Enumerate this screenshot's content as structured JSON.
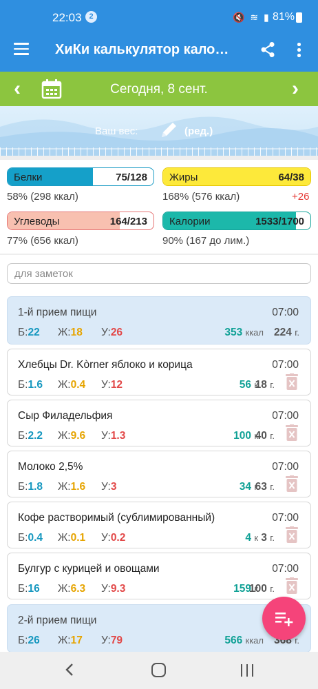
{
  "status_bar": {
    "time": "22:03",
    "notification_count": "2",
    "icons": "🔇 ≋ ▮",
    "battery": "81%"
  },
  "app_bar": {
    "title": "ХиКи калькулятор кало…"
  },
  "date_bar": {
    "date": "Сегодня, 8 сент."
  },
  "weight": {
    "label": "Ваш вес:",
    "edit": "(ред.)"
  },
  "macros": {
    "protein": {
      "name": "Белки",
      "value": "75/128",
      "fill": 0.586,
      "sub": "58% (298 ккал)"
    },
    "fat": {
      "name": "Жиры",
      "value": "64/38",
      "fill": 1.0,
      "sub": "168% (576 ккал)",
      "over": "+26"
    },
    "carbs": {
      "name": "Углеводы",
      "value": "164/213",
      "fill": 0.77,
      "sub": "77% (656 ккал)"
    },
    "calories": {
      "name": "Калории",
      "value": "1533/1700",
      "fill": 0.9,
      "sub": "90% (167 до лим.)"
    }
  },
  "notes": {
    "placeholder": "для заметок"
  },
  "labels": {
    "p": "Б:",
    "f": "Ж:",
    "c": "У:",
    "kcal": "ккал",
    "k": "к",
    "g": "г."
  },
  "entries": [
    {
      "kind": "meal",
      "title": "1-й прием пищи",
      "time": "07:00",
      "p": "22",
      "f": "18",
      "c": "26",
      "kcal": "353",
      "grams": "224"
    },
    {
      "kind": "food",
      "title": "Хлебцы Dr. Kòrner яблоко и корица",
      "time": "07:00",
      "p": "1.6",
      "f": "0.4",
      "c": "12",
      "kcal": "56",
      "grams": "18"
    },
    {
      "kind": "food",
      "title": "Сыр Филадельфия",
      "time": "07:00",
      "p": "2.2",
      "f": "9.6",
      "c": "1.3",
      "kcal": "100",
      "grams": "40"
    },
    {
      "kind": "food",
      "title": "Молоко 2,5%",
      "time": "07:00",
      "p": "1.8",
      "f": "1.6",
      "c": "3",
      "kcal": "34",
      "grams": "63"
    },
    {
      "kind": "food",
      "title": "Кофе растворимый (сублимированный)",
      "time": "07:00",
      "p": "0.4",
      "f": "0.1",
      "c": "0.2",
      "kcal": "4",
      "grams": "3"
    },
    {
      "kind": "food",
      "title": "Булгур с курицей и овощами",
      "time": "07:00",
      "p": "16",
      "f": "6.3",
      "c": "9.3",
      "kcal": "159",
      "grams": "100"
    },
    {
      "kind": "meal",
      "title": "2-й прием пищи",
      "time": "",
      "p": "26",
      "f": "17",
      "c": "79",
      "kcal": "566",
      "grams": "368"
    }
  ],
  "colors": {
    "primary": "#2f8fe0",
    "date_bar": "#8cc53f",
    "protein": "#15a0c9",
    "fat": "#fde93a",
    "carbs": "#f8c0b0",
    "calories": "#1cb8aa",
    "fab": "#f5447a"
  }
}
